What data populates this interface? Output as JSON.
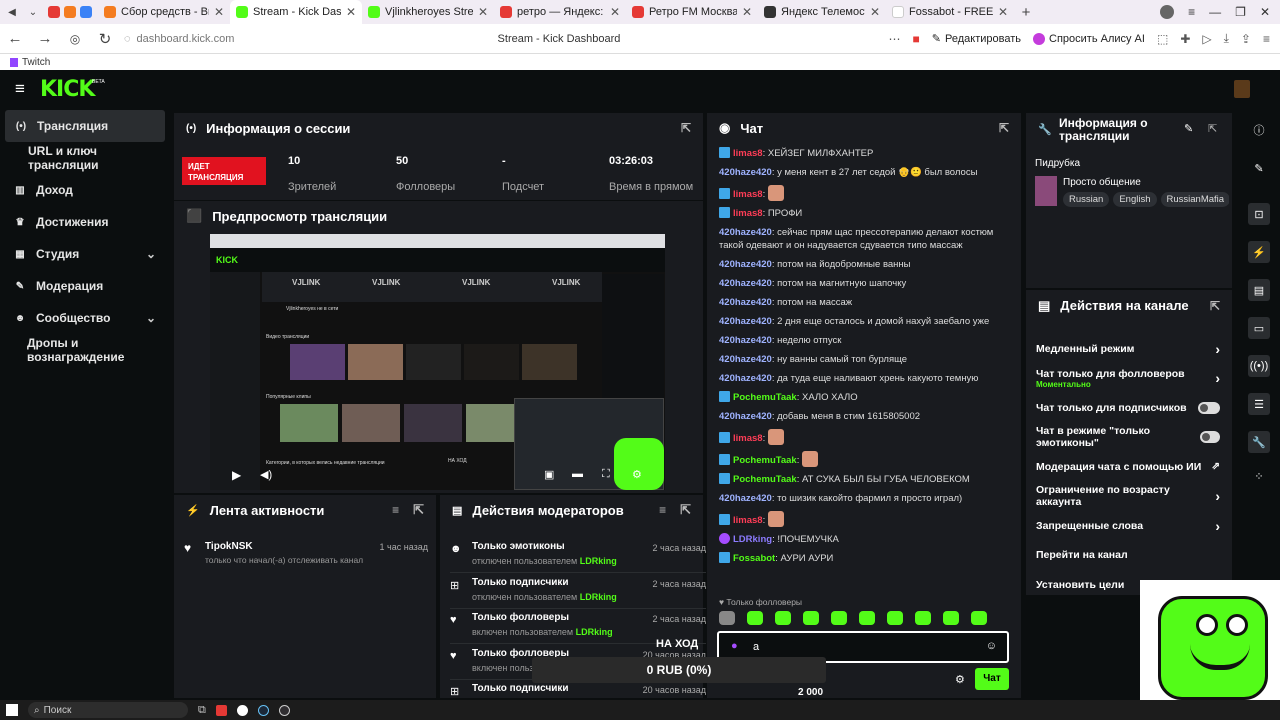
{
  "browser": {
    "tabs": [
      {
        "label": "Сбор средств - Виджеты",
        "color": "#f47c20"
      },
      {
        "label": "Stream - Kick Dashboard",
        "color": "#53fc18",
        "active": true
      },
      {
        "label": "Vjlinkheroyes Stream - Wa",
        "color": "#53fc18"
      },
      {
        "label": "ретро — Яндекс: нашлось",
        "color": "#e53935"
      },
      {
        "label": "Ретро FM Москва - с",
        "color": "#e53935"
      },
      {
        "label": "Яндекс Телемост — бе",
        "color": "#333333"
      },
      {
        "label": "Fossabot - FREE, cloud ho",
        "color": "#ffffff"
      }
    ],
    "url": "dashboard.kick.com",
    "page_title": "Stream - Kick Dashboard",
    "edit_label": "Редактировать",
    "alice_label": "Спросить Алису AI",
    "bookmark": "Twitch"
  },
  "kick": {
    "logo": "KICK",
    "logo_beta": "BETA"
  },
  "sidebar": {
    "items": [
      {
        "label": "Трансляция",
        "icon": "broadcast-icon"
      },
      {
        "label": "URL и ключ трансляции",
        "icon": ""
      },
      {
        "label": "Доход",
        "icon": "chart-icon"
      },
      {
        "label": "Достижения",
        "icon": "trophy-icon"
      },
      {
        "label": "Студия",
        "icon": "studio-icon"
      },
      {
        "label": "Модерация",
        "icon": "wrench-icon"
      },
      {
        "label": "Сообщество",
        "icon": "people-icon"
      },
      {
        "label": "Дропы и вознаграждение",
        "icon": ""
      }
    ]
  },
  "session": {
    "title": "Информация о сессии",
    "live_label": "ИДЕТ ТРАНСЛЯЦИЯ",
    "stats": [
      {
        "value": "10",
        "label": "Зрителей"
      },
      {
        "value": "50",
        "label": "Фолловеры"
      },
      {
        "value": "-",
        "label": "Подсчет"
      },
      {
        "value": "03:26:03",
        "label": "Время в прямом"
      }
    ]
  },
  "preview": {
    "title": "Предпросмотр трансляции",
    "inner_tabs": [
      "VJLINK",
      "VJLINK",
      "VJLINK",
      "VJLINK"
    ],
    "inner_section1": "Видео трансляции",
    "inner_section2": "Популярные клипы",
    "inner_section3": "Категории, в которых велись недавние трансляции",
    "inner_channel": "Vjlinkheroyes не в сети",
    "inner_goal": "НА ХОД"
  },
  "activity": {
    "title": "Лента активности",
    "items": [
      {
        "name": "TipokNSK",
        "time": "1 час назад",
        "desc": "только что начал(-а) отслеживать канал"
      }
    ]
  },
  "modlog": {
    "title": "Действия модераторов",
    "items": [
      {
        "title": "Только эмотиконы",
        "prefix": "отключен пользователем",
        "user": "LDRking",
        "time": "2 часа назад",
        "icon": "smile-icon"
      },
      {
        "title": "Только подписчики",
        "prefix": "отключен пользователем",
        "user": "LDRking",
        "time": "2 часа назад",
        "icon": "gift-icon"
      },
      {
        "title": "Только фолловеры",
        "prefix": "включен пользователем",
        "user": "LDRking",
        "time": "2 часа назад",
        "icon": "heart-icon"
      },
      {
        "title": "Только фолловеры",
        "prefix": "включен польз",
        "user": "",
        "time": "20 часов назад",
        "icon": "heart-icon"
      },
      {
        "title": "Только подписчики",
        "prefix": "",
        "user": "",
        "time": "20 часов назад",
        "icon": "gift-icon"
      }
    ]
  },
  "chat": {
    "title": "Чат",
    "messages": [
      {
        "user": "limas8",
        "ucls": "u2",
        "badge": true,
        "text": ": ХЕЙЗЕГ МИЛФХАНТЕР"
      },
      {
        "user": "420haze420",
        "ucls": "u1",
        "badge": false,
        "text": ": у меня кент в 27 лет седой 👴🙂 был волосы"
      },
      {
        "user": "limas8",
        "ucls": "u2",
        "badge": true,
        "text": ":",
        "emote": true
      },
      {
        "user": "limas8",
        "ucls": "u2",
        "badge": true,
        "text": ": ПРОФИ"
      },
      {
        "user": "420haze420",
        "ucls": "u1",
        "badge": false,
        "text": ": сейчас прям щас прессотерапию делают костюм такой одевают и он надувается сдувается типо массаж"
      },
      {
        "user": "420haze420",
        "ucls": "u1",
        "badge": false,
        "text": ": потом на йодобромные ванны"
      },
      {
        "user": "420haze420",
        "ucls": "u1",
        "badge": false,
        "text": ": потом на магнитную шапочку"
      },
      {
        "user": "420haze420",
        "ucls": "u1",
        "badge": false,
        "text": ": потом на массаж"
      },
      {
        "user": "420haze420",
        "ucls": "u1",
        "badge": false,
        "text": ": 2 дня еще осталось и домой нахуй заебало уже"
      },
      {
        "user": "420haze420",
        "ucls": "u1",
        "badge": false,
        "text": ": неделю отпуск"
      },
      {
        "user": "420haze420",
        "ucls": "u1",
        "badge": false,
        "text": ": ну ванны самый топ бурляще"
      },
      {
        "user": "420haze420",
        "ucls": "u1",
        "badge": false,
        "text": ": да туда еще наливают хрень какуюто темную"
      },
      {
        "user": "PochemuTaak",
        "ucls": "u3",
        "badge": true,
        "text": ": ХАЛО ХАЛО"
      },
      {
        "user": "420haze420",
        "ucls": "u1",
        "badge": false,
        "text": ": добавь меня в стим 1615805002"
      },
      {
        "user": "limas8",
        "ucls": "u2",
        "badge": true,
        "text": ":",
        "emote": true
      },
      {
        "user": "PochemuTaak",
        "ucls": "u3",
        "badge": true,
        "text": ":",
        "emote": true
      },
      {
        "user": "PochemuTaak",
        "ucls": "u3",
        "badge": true,
        "text": ": АТ СУКА БЫЛ БЫ ГУБА ЧЕЛОВЕКОМ"
      },
      {
        "user": "420haze420",
        "ucls": "u1",
        "badge": false,
        "text": ": то шизик какойто фармил я просто играл)"
      },
      {
        "user": "limas8",
        "ucls": "u2",
        "badge": true,
        "text": ":",
        "emote": true
      },
      {
        "user": "LDRking",
        "ucls": "u4",
        "badge": true,
        "text": ": !ПОЧЕМУЧКА"
      },
      {
        "user": "Fossabot",
        "ucls": "u3",
        "badge": true,
        "text": ": АУРИ АУРИ"
      }
    ],
    "followers_only": "Только фолловеры",
    "input_value": "а",
    "send_label": "Чат"
  },
  "donation": {
    "goal_label": "НА ХОД",
    "amount": "0 RUB (0%)",
    "goal_total": "2 000"
  },
  "broadcast_info": {
    "title": "Информация о трансляции",
    "category": "Пидрубка",
    "stream_title": "Просто общение",
    "tags": [
      "Russian",
      "English",
      "RussianMafia"
    ]
  },
  "channel_actions": {
    "title": "Действия на канале",
    "items": [
      {
        "label": "Медленный режим",
        "sub": "",
        "control": "chevron"
      },
      {
        "label": "Чат только для фолловеров",
        "sub": "Моментально",
        "control": "chevron"
      },
      {
        "label": "Чат только для подписчиков",
        "sub": "",
        "control": "toggle"
      },
      {
        "label": "Чат в режиме \"только эмотиконы\"",
        "sub": "",
        "control": "toggle"
      },
      {
        "label": "Модерация чата с помощью ИИ",
        "sub": "",
        "control": "external"
      },
      {
        "label": "Ограничение по возрасту аккаунта",
        "sub": "",
        "control": "chevron"
      },
      {
        "label": "Запрещенные слова",
        "sub": "",
        "control": "chevron"
      },
      {
        "label": "Перейти на канал",
        "sub": "",
        "control": "none"
      },
      {
        "label": "Установить цели",
        "sub": "",
        "control": "chevron"
      }
    ]
  },
  "taskbar": {
    "search_placeholder": "Поиск"
  }
}
